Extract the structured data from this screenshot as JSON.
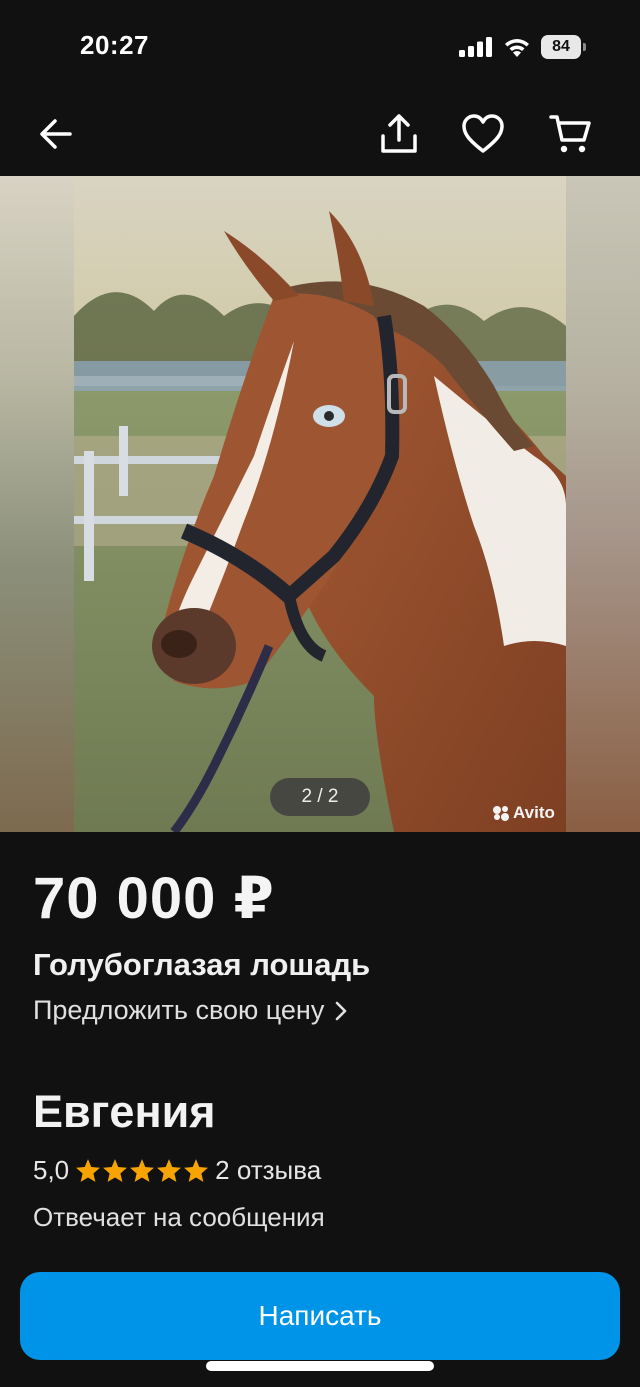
{
  "status_bar": {
    "time": "20:27",
    "battery": "84"
  },
  "nav": {
    "back_icon": "arrow-left-icon",
    "share_icon": "share-icon",
    "favorite_icon": "heart-icon",
    "cart_icon": "cart-icon"
  },
  "gallery": {
    "counter": "2 / 2",
    "watermark": "Avito"
  },
  "listing": {
    "price": "70 000 ₽",
    "title": "Голубоглазая лошадь",
    "offer_link": "Предложить свою цену"
  },
  "seller": {
    "name": "Евгения",
    "rating": "5,0",
    "stars": 5,
    "reviews": "2 отзыва",
    "reply_status": "Отвечает на сообщения"
  },
  "actions": {
    "write_button": "Написать"
  },
  "colors": {
    "background": "#111111",
    "accent": "#0094e8",
    "star": "#f7a400"
  }
}
